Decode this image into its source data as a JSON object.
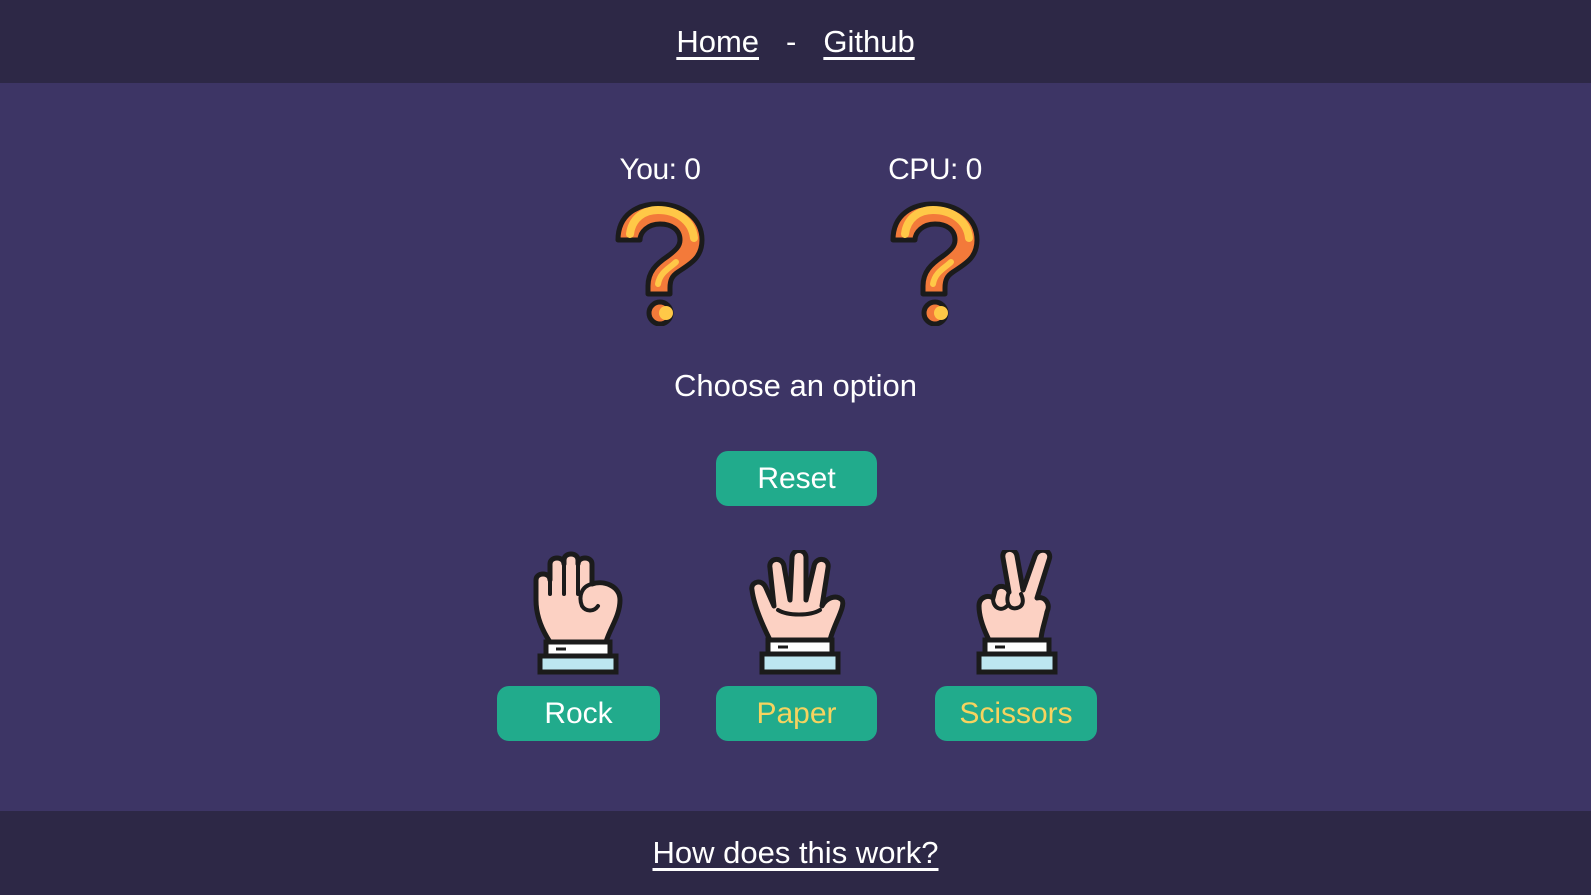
{
  "nav": {
    "home": "Home",
    "separator": "-",
    "github": "Github"
  },
  "scores": {
    "you_label": "You: 0",
    "cpu_label": "CPU: 0"
  },
  "prompt": "Choose an option",
  "buttons": {
    "reset": "Reset",
    "rock": "Rock",
    "paper": "Paper",
    "scissors": "Scissors"
  },
  "footer": {
    "link": "How does this work?"
  },
  "colors": {
    "bar_bg": "#2d2846",
    "main_bg": "#3d3565",
    "button_bg": "#21ab8c",
    "text": "#ffffff",
    "highlight_text": "#f6d35f",
    "question_orange": "#f37a3a",
    "question_yellow": "#ffc847",
    "skin": "#fcd1c3",
    "cuff": "#bde7f0"
  },
  "icons": {
    "player_choice": "question-mark-icon",
    "cpu_choice": "question-mark-icon",
    "rock": "fist-hand-icon",
    "paper": "open-hand-icon",
    "scissors": "peace-hand-icon"
  }
}
